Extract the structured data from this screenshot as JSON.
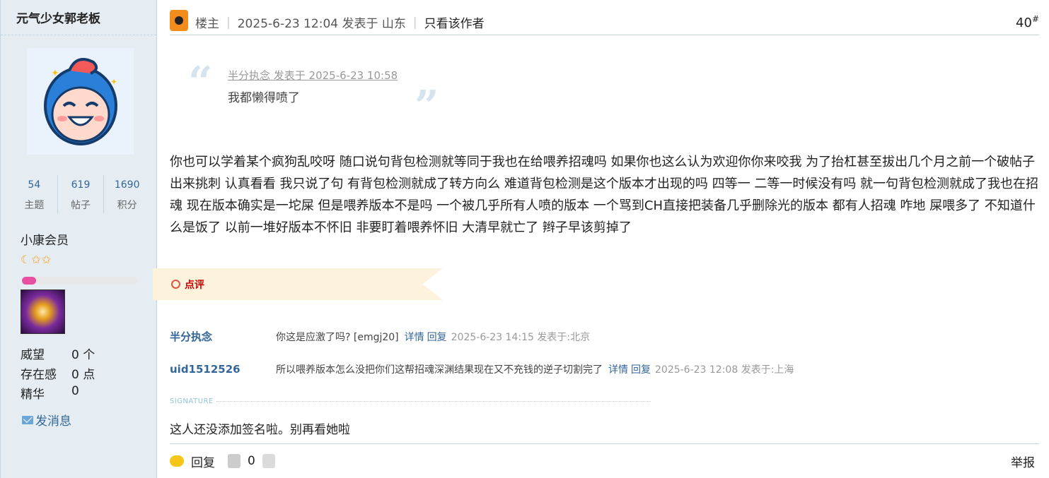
{
  "author": {
    "name": "元气少女郭老板",
    "stats": [
      {
        "value": "54",
        "label": "主题"
      },
      {
        "value": "619",
        "label": "帖子"
      },
      {
        "value": "1690",
        "label": "积分"
      }
    ],
    "group": "小康会员",
    "level_progress_percent": 12,
    "meta": [
      {
        "key": "威望",
        "value": "0 个"
      },
      {
        "key": "存在感",
        "value": "0 点"
      },
      {
        "key": "精华",
        "value": "0"
      }
    ],
    "send_message_label": "发消息"
  },
  "post": {
    "role": "楼主",
    "time": "2025-6-23 12:04 发表于 山东",
    "author_only_label": "只看该作者",
    "floor": "40",
    "floor_sup": "#",
    "quote": {
      "source": "半分执念 发表于 2025-6-23 10:58",
      "text": "我都懒得喷了"
    },
    "body": "你也可以学着某个疯狗乱咬呀 随口说句背包检测就等同于我也在给喂养招魂吗 如果你也这么认为欢迎你你来咬我 为了抬杠甚至拔出几个月之前一个破帖子出来挑刺  认真看看 我只说了句 有背包检测就成了转方向么 难道背包检测是这个版本才出现的吗 四等一 二等一时候没有吗 就一句背包检测就成了我也在招魂  现在版本确实是一坨屎 但是喂养版本不是吗  一个被几乎所有人喷的版本 一个骂到CH直接把装备几乎删除光的版本 都有人招魂 咋地 屎喂多了 不知道什么是饭了 以前一堆好版本不怀旧  非要盯着喂养怀旧 大清早就亡了 辫子早该剪掉了",
    "review_label": "点评",
    "comments": [
      {
        "user": "半分执念",
        "text": "你这是应激了吗?  [emgj20]",
        "detail": "详情",
        "reply": "回复",
        "time": "2025-6-23 14:15 发表于:北京"
      },
      {
        "user": "uid1512526",
        "text": "所以喂养版本怎么没把你们这帮招魂深渊结果现在又不充钱的逆子切割完了",
        "detail": "详情",
        "reply": "回复",
        "time": "2025-6-23 12:08 发表于:上海"
      }
    ],
    "signature_label": "SIGNATURE",
    "signature": "这人还没添加签名啦。别再看她啦",
    "footer": {
      "reply_label": "回复",
      "like_count": "0",
      "report_label": "举报"
    }
  }
}
